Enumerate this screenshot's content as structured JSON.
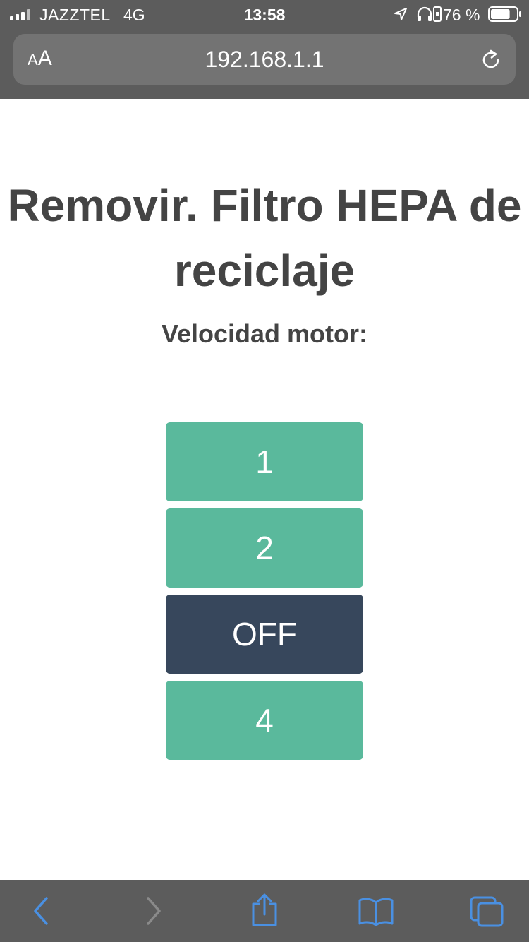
{
  "status_bar": {
    "carrier": "JAZZTEL",
    "network": "4G",
    "time": "13:58",
    "battery_percent": "76 %",
    "battery_level": 0.76,
    "icons": [
      "signal-icon",
      "location-arrow-icon",
      "headphones-icon",
      "rotation-lock-icon",
      "battery-icon"
    ]
  },
  "browser": {
    "text_size_label_small": "A",
    "text_size_label_large": "A",
    "url": "192.168.1.1",
    "reload_icon": "reload-icon"
  },
  "page": {
    "title": "Removir. Filtro HEPA de reciclaje",
    "subtitle": "Velocidad motor:",
    "buttons": [
      {
        "label": "1",
        "active": false
      },
      {
        "label": "2",
        "active": false
      },
      {
        "label": "OFF",
        "active": true
      },
      {
        "label": "4",
        "active": false
      }
    ],
    "colors": {
      "button": "#5ab99c",
      "button_active": "#37475c",
      "text": "#444444"
    }
  },
  "toolbar": {
    "icons": [
      "back-icon",
      "forward-icon",
      "share-icon",
      "bookmarks-icon",
      "tabs-icon"
    ],
    "accent": "#4a90e2"
  }
}
